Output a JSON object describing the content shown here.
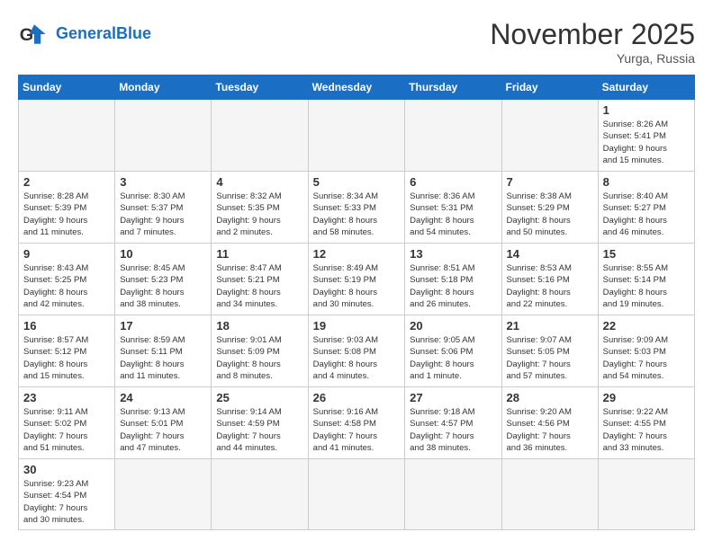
{
  "header": {
    "logo_general": "General",
    "logo_blue": "Blue",
    "month_title": "November 2025",
    "location": "Yurga, Russia"
  },
  "weekdays": [
    "Sunday",
    "Monday",
    "Tuesday",
    "Wednesday",
    "Thursday",
    "Friday",
    "Saturday"
  ],
  "days": [
    {
      "num": "",
      "info": ""
    },
    {
      "num": "",
      "info": ""
    },
    {
      "num": "",
      "info": ""
    },
    {
      "num": "",
      "info": ""
    },
    {
      "num": "",
      "info": ""
    },
    {
      "num": "",
      "info": ""
    },
    {
      "num": "1",
      "info": "Sunrise: 8:26 AM\nSunset: 5:41 PM\nDaylight: 9 hours\nand 15 minutes."
    },
    {
      "num": "2",
      "info": "Sunrise: 8:28 AM\nSunset: 5:39 PM\nDaylight: 9 hours\nand 11 minutes."
    },
    {
      "num": "3",
      "info": "Sunrise: 8:30 AM\nSunset: 5:37 PM\nDaylight: 9 hours\nand 7 minutes."
    },
    {
      "num": "4",
      "info": "Sunrise: 8:32 AM\nSunset: 5:35 PM\nDaylight: 9 hours\nand 2 minutes."
    },
    {
      "num": "5",
      "info": "Sunrise: 8:34 AM\nSunset: 5:33 PM\nDaylight: 8 hours\nand 58 minutes."
    },
    {
      "num": "6",
      "info": "Sunrise: 8:36 AM\nSunset: 5:31 PM\nDaylight: 8 hours\nand 54 minutes."
    },
    {
      "num": "7",
      "info": "Sunrise: 8:38 AM\nSunset: 5:29 PM\nDaylight: 8 hours\nand 50 minutes."
    },
    {
      "num": "8",
      "info": "Sunrise: 8:40 AM\nSunset: 5:27 PM\nDaylight: 8 hours\nand 46 minutes."
    },
    {
      "num": "9",
      "info": "Sunrise: 8:43 AM\nSunset: 5:25 PM\nDaylight: 8 hours\nand 42 minutes."
    },
    {
      "num": "10",
      "info": "Sunrise: 8:45 AM\nSunset: 5:23 PM\nDaylight: 8 hours\nand 38 minutes."
    },
    {
      "num": "11",
      "info": "Sunrise: 8:47 AM\nSunset: 5:21 PM\nDaylight: 8 hours\nand 34 minutes."
    },
    {
      "num": "12",
      "info": "Sunrise: 8:49 AM\nSunset: 5:19 PM\nDaylight: 8 hours\nand 30 minutes."
    },
    {
      "num": "13",
      "info": "Sunrise: 8:51 AM\nSunset: 5:18 PM\nDaylight: 8 hours\nand 26 minutes."
    },
    {
      "num": "14",
      "info": "Sunrise: 8:53 AM\nSunset: 5:16 PM\nDaylight: 8 hours\nand 22 minutes."
    },
    {
      "num": "15",
      "info": "Sunrise: 8:55 AM\nSunset: 5:14 PM\nDaylight: 8 hours\nand 19 minutes."
    },
    {
      "num": "16",
      "info": "Sunrise: 8:57 AM\nSunset: 5:12 PM\nDaylight: 8 hours\nand 15 minutes."
    },
    {
      "num": "17",
      "info": "Sunrise: 8:59 AM\nSunset: 5:11 PM\nDaylight: 8 hours\nand 11 minutes."
    },
    {
      "num": "18",
      "info": "Sunrise: 9:01 AM\nSunset: 5:09 PM\nDaylight: 8 hours\nand 8 minutes."
    },
    {
      "num": "19",
      "info": "Sunrise: 9:03 AM\nSunset: 5:08 PM\nDaylight: 8 hours\nand 4 minutes."
    },
    {
      "num": "20",
      "info": "Sunrise: 9:05 AM\nSunset: 5:06 PM\nDaylight: 8 hours\nand 1 minute."
    },
    {
      "num": "21",
      "info": "Sunrise: 9:07 AM\nSunset: 5:05 PM\nDaylight: 7 hours\nand 57 minutes."
    },
    {
      "num": "22",
      "info": "Sunrise: 9:09 AM\nSunset: 5:03 PM\nDaylight: 7 hours\nand 54 minutes."
    },
    {
      "num": "23",
      "info": "Sunrise: 9:11 AM\nSunset: 5:02 PM\nDaylight: 7 hours\nand 51 minutes."
    },
    {
      "num": "24",
      "info": "Sunrise: 9:13 AM\nSunset: 5:01 PM\nDaylight: 7 hours\nand 47 minutes."
    },
    {
      "num": "25",
      "info": "Sunrise: 9:14 AM\nSunset: 4:59 PM\nDaylight: 7 hours\nand 44 minutes."
    },
    {
      "num": "26",
      "info": "Sunrise: 9:16 AM\nSunset: 4:58 PM\nDaylight: 7 hours\nand 41 minutes."
    },
    {
      "num": "27",
      "info": "Sunrise: 9:18 AM\nSunset: 4:57 PM\nDaylight: 7 hours\nand 38 minutes."
    },
    {
      "num": "28",
      "info": "Sunrise: 9:20 AM\nSunset: 4:56 PM\nDaylight: 7 hours\nand 36 minutes."
    },
    {
      "num": "29",
      "info": "Sunrise: 9:22 AM\nSunset: 4:55 PM\nDaylight: 7 hours\nand 33 minutes."
    },
    {
      "num": "30",
      "info": "Sunrise: 9:23 AM\nSunset: 4:54 PM\nDaylight: 7 hours\nand 30 minutes."
    },
    {
      "num": "",
      "info": ""
    },
    {
      "num": "",
      "info": ""
    },
    {
      "num": "",
      "info": ""
    },
    {
      "num": "",
      "info": ""
    },
    {
      "num": "",
      "info": ""
    },
    {
      "num": "",
      "info": ""
    }
  ]
}
